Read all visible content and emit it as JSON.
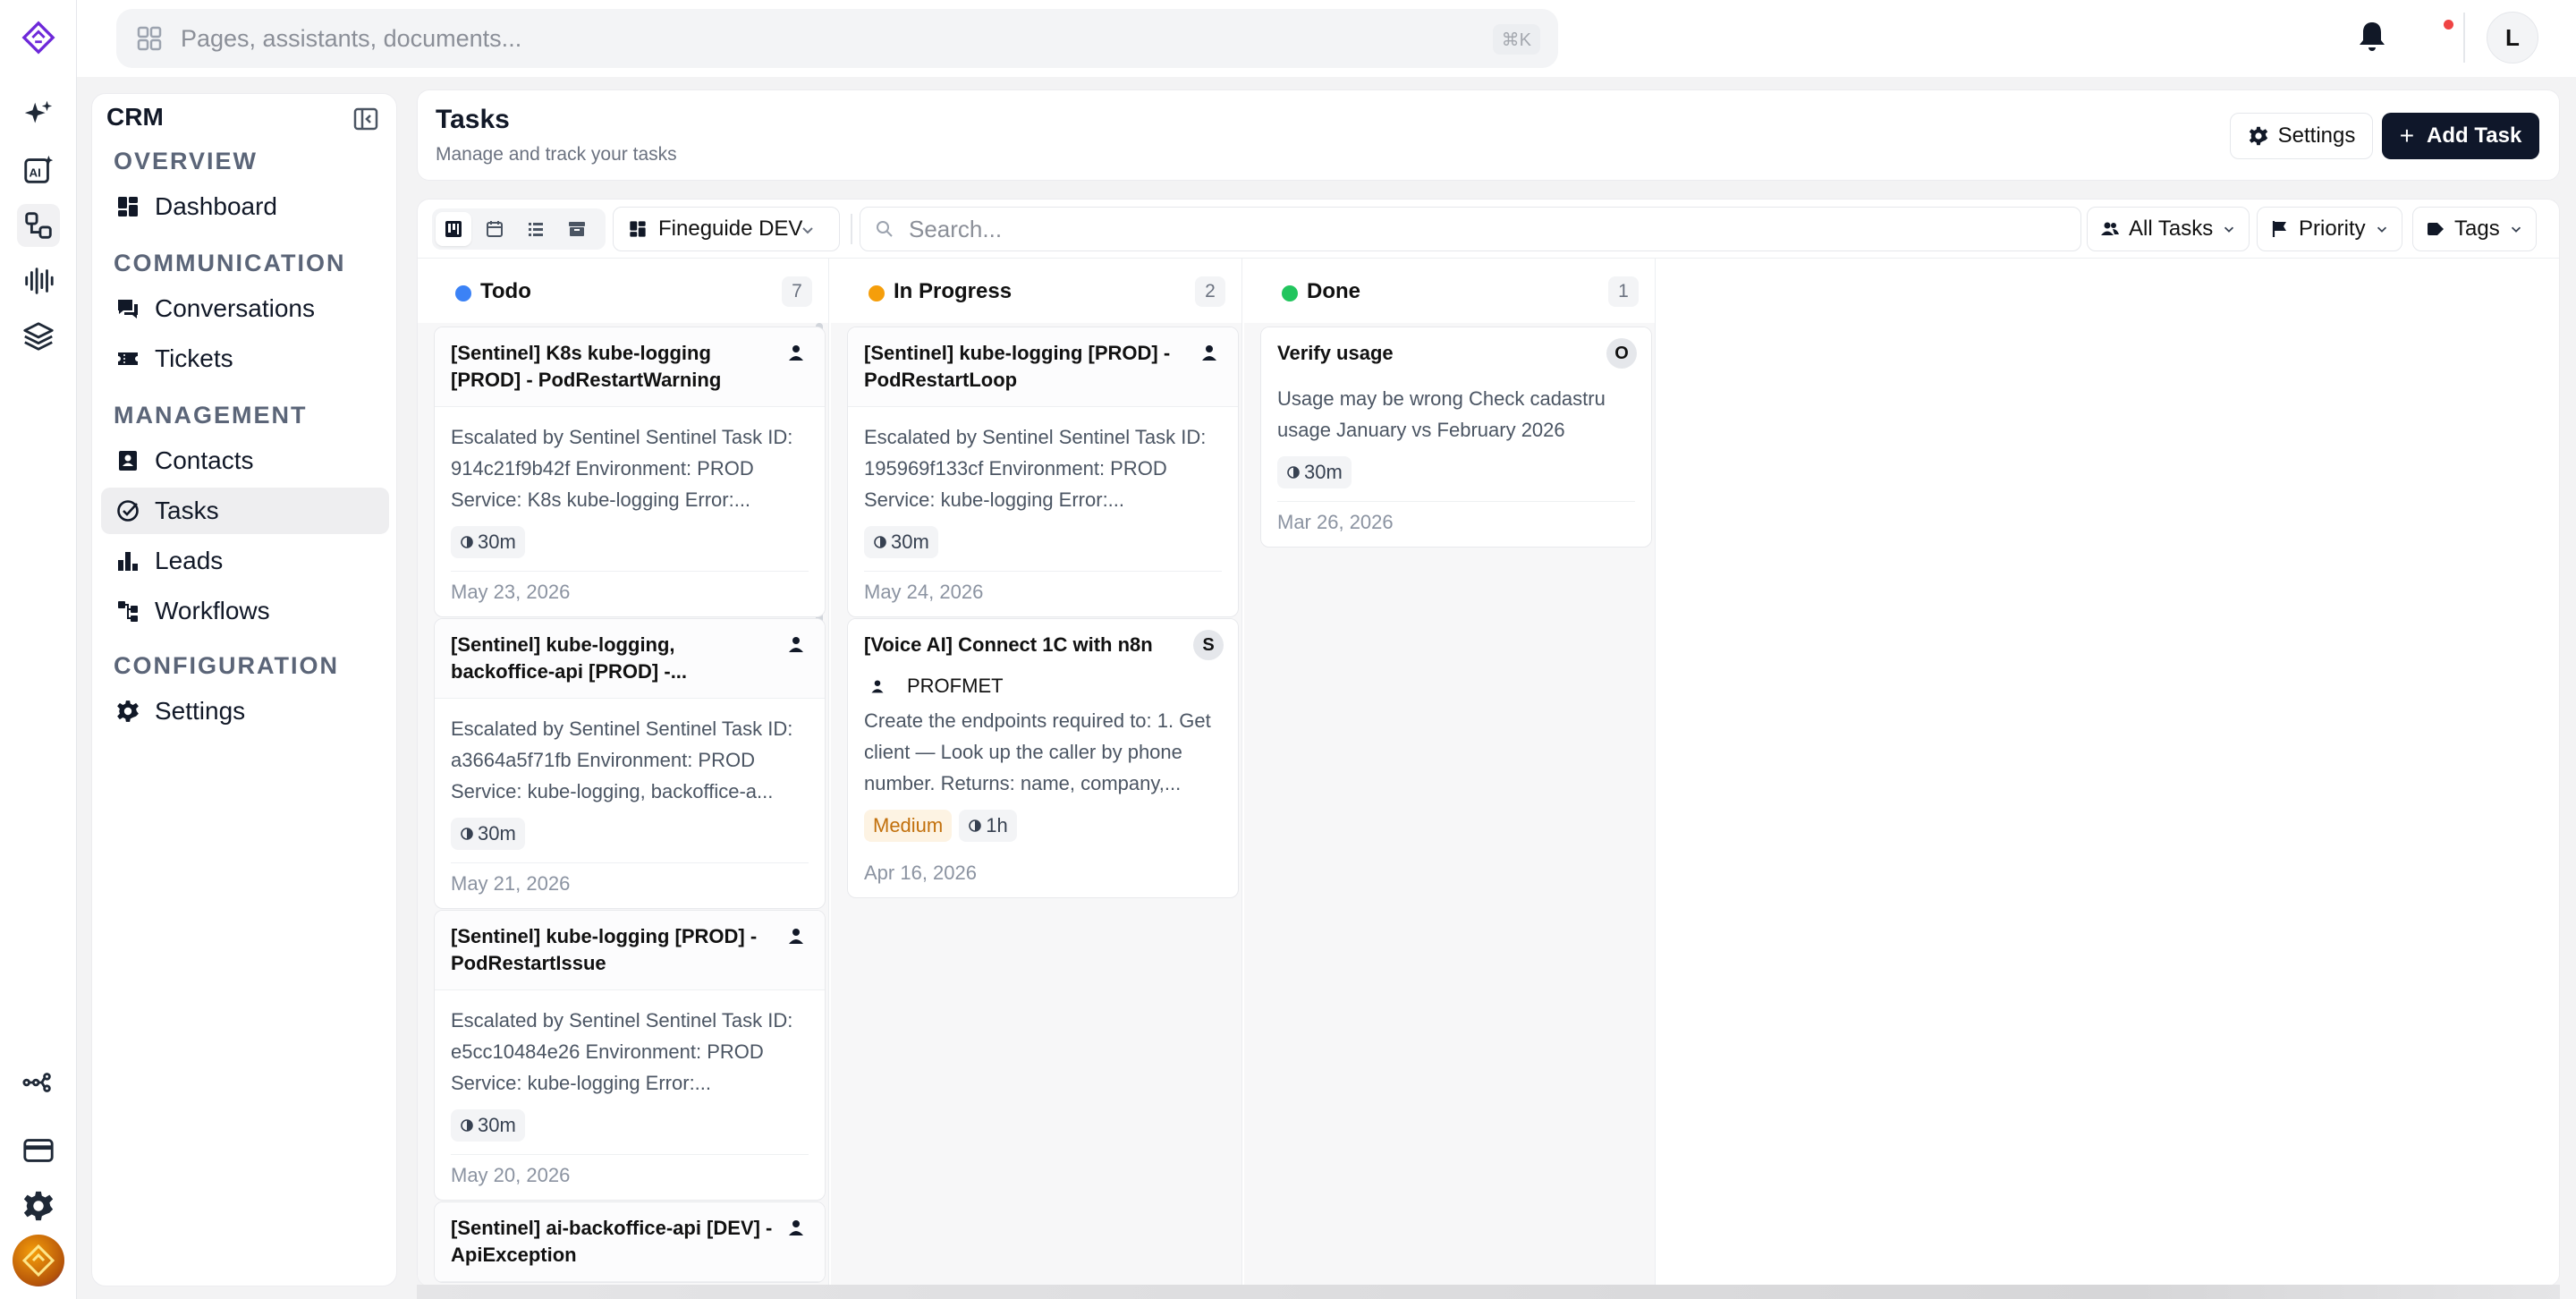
{
  "app": {
    "search_placeholder": "Pages, assistants, documents...",
    "search_shortcut": "⌘K",
    "user_initial": "L",
    "accent_color": "#6d28d9"
  },
  "rail": {
    "icons": [
      "logo-icon",
      "sparkles-icon",
      "ai-icon",
      "workflow-icon",
      "audio-wave-icon",
      "layers-icon",
      "integrations-icon",
      "billing-card-icon",
      "settings-gear-icon",
      "brand-avatar"
    ]
  },
  "sidebar": {
    "title": "CRM",
    "sections": [
      {
        "label": "OVERVIEW"
      },
      {
        "label": "COMMUNICATION"
      },
      {
        "label": "MANAGEMENT"
      },
      {
        "label": "CONFIGURATION"
      }
    ],
    "items": [
      {
        "label": "Dashboard",
        "icon": "dashboard-icon"
      },
      {
        "label": "Conversations",
        "icon": "chat-icon"
      },
      {
        "label": "Tickets",
        "icon": "ticket-icon"
      },
      {
        "label": "Contacts",
        "icon": "contacts-icon"
      },
      {
        "label": "Tasks",
        "icon": "check-circle-icon",
        "active": true
      },
      {
        "label": "Leads",
        "icon": "bar-chart-icon"
      },
      {
        "label": "Workflows",
        "icon": "workflow-icon"
      },
      {
        "label": "Settings",
        "icon": "gear-icon"
      }
    ]
  },
  "header": {
    "title": "Tasks",
    "subtitle": "Manage and track your tasks",
    "settings_label": "Settings",
    "add_label": "Add Task"
  },
  "toolbar": {
    "workspace": "Fineguide DEV",
    "search_placeholder": "Search...",
    "filter_tasks": "All Tasks",
    "filter_priority": "Priority",
    "filter_tags": "Tags"
  },
  "columns": [
    {
      "title": "Todo",
      "count": "7",
      "color": "#3b82f6",
      "cards": [
        {
          "title": "[Sentinel] K8s kube-logging [PROD] - PodRestartWarning",
          "desc": "Escalated by Sentinel Sentinel Task ID: 914c21f9b42f Environment: PROD Service: K8s kube-logging Error:...",
          "time": "30m",
          "date": "May 23, 2026"
        },
        {
          "title": "[Sentinel] kube-logging, backoffice-api [PROD] -...",
          "desc": "Escalated by Sentinel Sentinel Task ID: a3664a5f71fb Environment: PROD Service: kube-logging, backoffice-a...",
          "time": "30m",
          "date": "May 21, 2026"
        },
        {
          "title": "[Sentinel] kube-logging [PROD] - PodRestartIssue",
          "desc": "Escalated by Sentinel Sentinel Task ID: e5cc10484e26 Environment: PROD Service: kube-logging Error:...",
          "time": "30m",
          "date": "May 20, 2026"
        },
        {
          "title": "[Sentinel] ai-backoffice-api [DEV] - ApiException",
          "desc": "",
          "time": "",
          "date": ""
        }
      ]
    },
    {
      "title": "In Progress",
      "count": "2",
      "color": "#f59e0b",
      "cards": [
        {
          "title": "[Sentinel] kube-logging [PROD] - PodRestartLoop",
          "desc": "Escalated by Sentinel Sentinel Task ID: 195969f133cf Environment: PROD Service: kube-logging Error:...",
          "time": "30m",
          "date": "May 24, 2026"
        },
        {
          "title": "[Voice AI] Connect 1C with n8n",
          "assignee": "S",
          "contact": "PROFMET",
          "desc": "Create the endpoints required to: 1. Get client — Look up the caller by phone number. Returns: name, company,...",
          "priority": "Medium",
          "time": "1h",
          "date": "Apr 16, 2026"
        }
      ]
    },
    {
      "title": "Done",
      "count": "1",
      "color": "#22c55e",
      "cards": [
        {
          "title": "Verify usage",
          "assignee": "O",
          "desc": "Usage may be wrong Check cadastru usage January vs February 2026",
          "time": "30m",
          "date": "Mar 26, 2026"
        }
      ]
    }
  ]
}
